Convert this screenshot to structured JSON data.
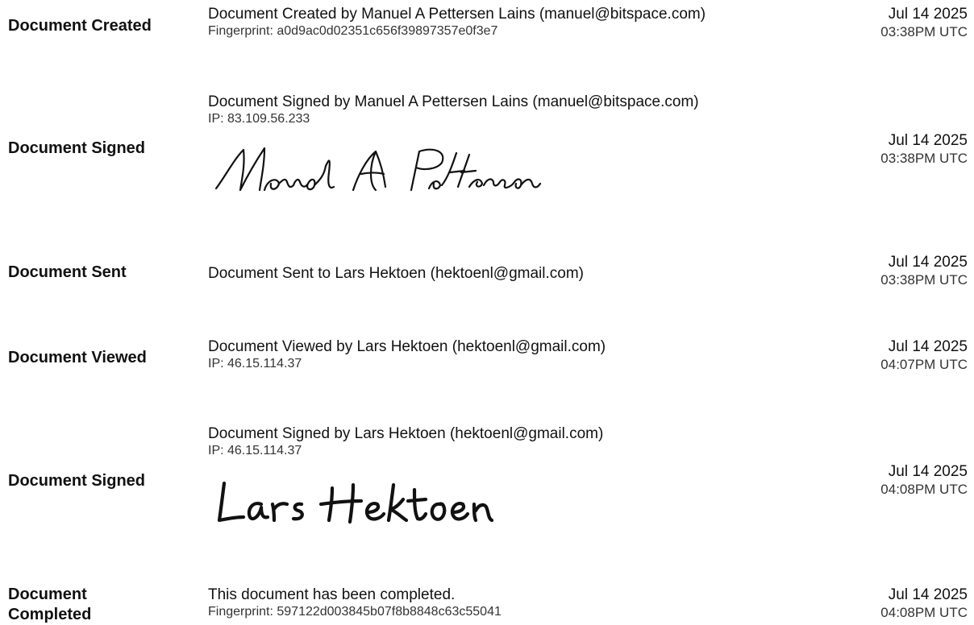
{
  "events": [
    {
      "label": "Document Created",
      "main": "Document Created by Manuel A Pettersen Lains (manuel@bitspace.com)",
      "sub": "Fingerprint: a0d9ac0d02351c656f39897357e0f3e7",
      "date": "Jul 14 2025",
      "time": "03:38PM UTC"
    },
    {
      "label": "Document Signed",
      "main": "Document Signed by Manuel A Pettersen Lains (manuel@bitspace.com)",
      "sub": "IP: 83.109.56.233",
      "signature": "Manuel A Pettersen Lains",
      "date": "Jul 14 2025",
      "time": "03:38PM UTC"
    },
    {
      "label": "Document Sent",
      "main": "Document Sent to Lars Hektoen (hektoenl@gmail.com)",
      "date": "Jul 14 2025",
      "time": "03:38PM UTC"
    },
    {
      "label": "Document Viewed",
      "main": "Document Viewed by Lars Hektoen (hektoenl@gmail.com)",
      "sub": "IP: 46.15.114.37",
      "date": "Jul 14 2025",
      "time": "04:07PM UTC"
    },
    {
      "label": "Document Signed",
      "main": "Document Signed by Lars Hektoen (hektoenl@gmail.com)",
      "sub": "IP: 46.15.114.37",
      "signature": "Lars Hektoen",
      "date": "Jul 14 2025",
      "time": "04:08PM UTC"
    },
    {
      "label_lines": [
        "Document",
        "Completed"
      ],
      "main": "This document has been completed.",
      "sub": "Fingerprint: 597122d003845b07f8b8848c63c55041",
      "date": "Jul 14 2025",
      "time": "04:08PM UTC"
    }
  ]
}
